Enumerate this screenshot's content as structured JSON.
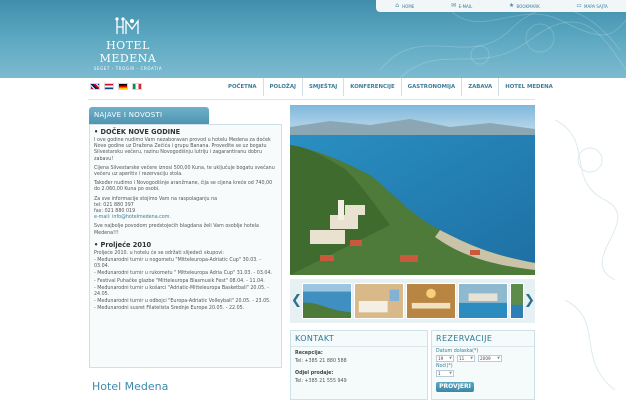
{
  "toplinks": [
    {
      "label": "Home",
      "icon": "house-icon"
    },
    {
      "label": "E-mail",
      "icon": "envelope-icon"
    },
    {
      "label": "Bookmark",
      "icon": "star-icon"
    },
    {
      "label": "Mapa sajta",
      "icon": "sitemap-icon"
    }
  ],
  "logo": {
    "title": "HOTEL MEDENA",
    "subtitle": "SEGET - TROGIR - CROATIA"
  },
  "languages": [
    "en",
    "hr",
    "de",
    "it"
  ],
  "nav": [
    "POČETNA",
    "POLOŽAJ",
    "SMJEŠTAJ",
    "KONFERENCIJE",
    "GASTRONOMIJA",
    "ZABAVA",
    "HOTEL MEDENA"
  ],
  "news": {
    "tab_label": "NAJAVE I NOVOSTI",
    "items": [
      {
        "title": "• DOČEK NOVE GODINE",
        "paragraphs": [
          "I ove godine nudimo Vam nezaboravan provod u hotelu Medena za doček Nove godine uz Draženа Zečića i grupu Banana. Provedite se uz bogatu Silvestarsku večeru, razinu Novogodišnju lutriju i zagarantiranu dobru zabavu!",
          "Cijena Silvestarske večere iznosi 500,00 Kuna, te uključuje bogatu svečanu večeru uz aperitiv i rezervaciju stola.",
          "Također nudimo i Novogodišnje aranžmane, čija se cijena kreće od 740,00 do 2.060,00 Kuna po osobi.",
          "Za sve informacije stojimo Vam na raspolaganju na",
          "tel: 021 880 397",
          "fax: 021 880 019",
          "e-mail: info@hotelmedena.com.",
          "Sve najbolje povodom predstojećih blagdana želi Vam osoblje hotela Medena!!!"
        ]
      },
      {
        "title": "• Proljeće 2010",
        "paragraphs": [
          "Proljeće 2010. u hotelu će se održati slijedeći skupovi:",
          "- Međunarodni turnir u nogometu \"Mitteleuropa-Adriatic Cup\" 30.03. - 03.04.",
          "- Međunarodni turnir u rukometu \" Mitteleuropa Adria Cup\" 31.03. - 03.04.",
          "- Festival Puhačke glazbe \"Mitteleuropa Blasmusik Fest\" 08.04. - 11.04.",
          "- Međunarodni turnir u košarci \"Adriatic-Mitteleuropa Basketball\" 20.05. - 24.05.",
          "- Međunarodni turnir u odbojci \"Europa-Adriatic Volleyball\" 20.05. - 23.05.",
          "- Međunarodni susret Filatelista Srednje Europe 20.05. - 22.05."
        ]
      }
    ]
  },
  "hotel_heading": "Hotel Medena",
  "gallery": {
    "prev_symbol": "❮",
    "next_symbol": "❯",
    "thumb_count": 5
  },
  "contact": {
    "title": "KONTAKT",
    "reception_label": "Recepcija:",
    "reception_tel": "Tel: +385 21 880 588",
    "sales_label": "Odjel prodaje:",
    "sales_tel": "Tel: +385 21 555 949"
  },
  "reservation": {
    "title": "REZERVACIJE",
    "arrival_label": "Datum dolaska(*)",
    "day": "19",
    "month": "11",
    "year": "2009",
    "nights_label": "Noći(*)",
    "nights": "1",
    "button": "PROVJERI"
  },
  "colors": {
    "header_top": "#3f8eac",
    "accent": "#3a7d99",
    "panel_bg": "#f7fbfc"
  }
}
